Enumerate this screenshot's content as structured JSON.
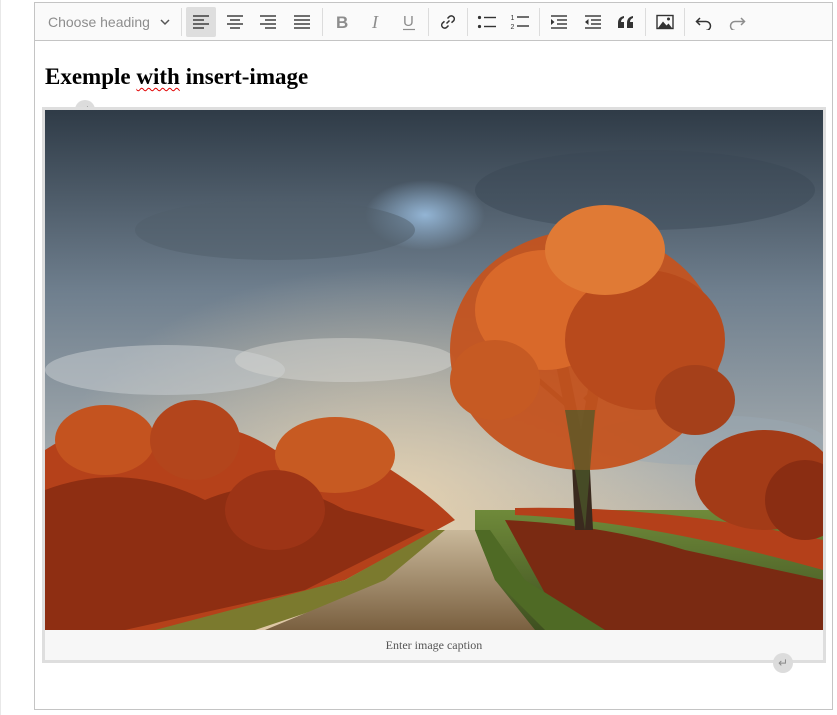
{
  "toolbar": {
    "heading_placeholder": "Choose heading",
    "buttons": [
      {
        "name": "align-left",
        "state": "active"
      },
      {
        "name": "align-center"
      },
      {
        "name": "align-right"
      },
      {
        "name": "align-justify"
      },
      {
        "name": "bold"
      },
      {
        "name": "italic"
      },
      {
        "name": "underline"
      },
      {
        "name": "link"
      },
      {
        "name": "bulleted-list"
      },
      {
        "name": "numbered-list"
      },
      {
        "name": "indent"
      },
      {
        "name": "outdent"
      },
      {
        "name": "block-quote"
      },
      {
        "name": "insert-image"
      },
      {
        "name": "undo"
      },
      {
        "name": "redo"
      }
    ],
    "icons": {
      "dropdown_caret": "chevron-down-icon",
      "line_break_handle": "return-arrow-icon"
    }
  },
  "content": {
    "title_word_1": "Exemple",
    "title_word_2": "with",
    "title_word_3": "insert-image",
    "image": {
      "subject": "autumn-tree-country-lane",
      "caption_placeholder": "Enter image caption"
    },
    "line_break_glyph": "↵"
  },
  "colors": {
    "spellcheck_underline": "#e00000",
    "active_button": "#dedede",
    "figure_border": "#dedede"
  }
}
